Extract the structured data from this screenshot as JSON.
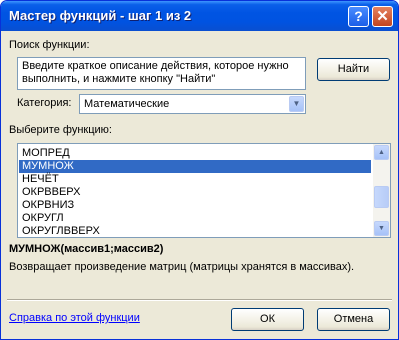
{
  "window": {
    "title": "Мастер функций - шаг 1 из 2",
    "help_glyph": "?",
    "close_glyph": "✕"
  },
  "search": {
    "label": "Поиск функции:",
    "description": "Введите краткое описание действия, которое нужно выполнить, и нажмите кнопку \"Найти\"",
    "find_button": "Найти"
  },
  "category": {
    "label": "Категория:",
    "value": "Математические"
  },
  "functions": {
    "label": "Выберите функцию:",
    "items": [
      "МОПРЕД",
      "МУМНОЖ",
      "НЕЧЁТ",
      "ОКРВВЕРХ",
      "ОКРВНИЗ",
      "ОКРУГЛ",
      "ОКРУГЛВВЕРХ"
    ],
    "selected": "МУМНОЖ"
  },
  "selected_function": {
    "signature": "МУМНОЖ(массив1;массив2)",
    "description": "Возвращает произведение матриц (матрицы хранятся в массивах)."
  },
  "footer": {
    "help_link": "Справка по этой функции",
    "ok_button": "ОК",
    "cancel_button": "Отмена"
  },
  "colors": {
    "title_bar": "#0054e3",
    "selection": "#316ac5",
    "dialog_bg": "#ece9d8",
    "link": "#0000ff"
  }
}
